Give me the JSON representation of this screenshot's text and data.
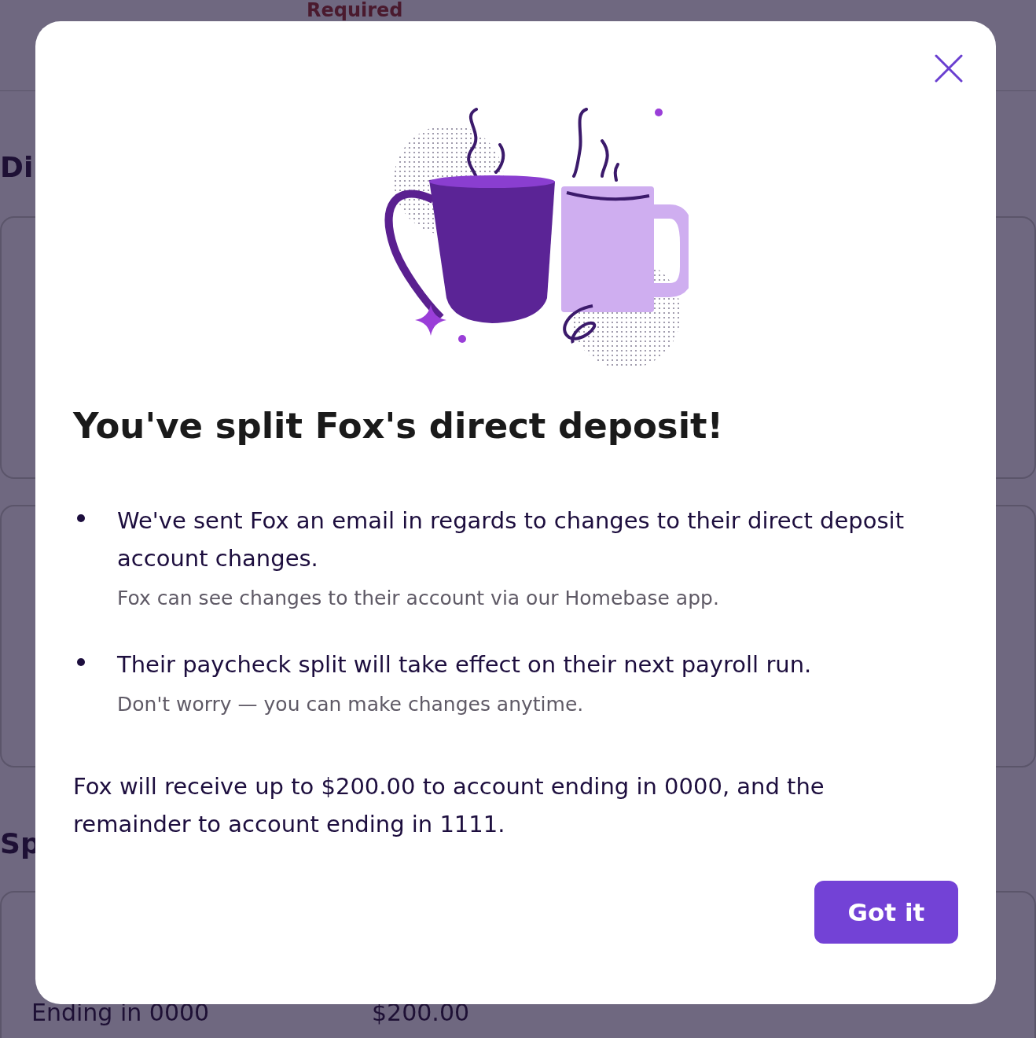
{
  "background": {
    "status": "Required",
    "headings": [
      "Di",
      "Sp"
    ],
    "account_row": {
      "account": "Ending in 0000",
      "amount": "$200.00"
    }
  },
  "modal": {
    "title": "You've split Fox's direct deposit!",
    "items": [
      {
        "text": "We've sent Fox an email in regards to changes to their direct deposit account changes.",
        "note": "Fox can see changes to their account via our Homebase app."
      },
      {
        "text": "Their paycheck split will take effect on their next payroll run.",
        "note": "Don't worry — you can make changes anytime."
      }
    ],
    "summary": "Fox will receive up to $200.00 to account ending in 0000, and the remainder to account ending in 1111.",
    "button": "Got it"
  }
}
